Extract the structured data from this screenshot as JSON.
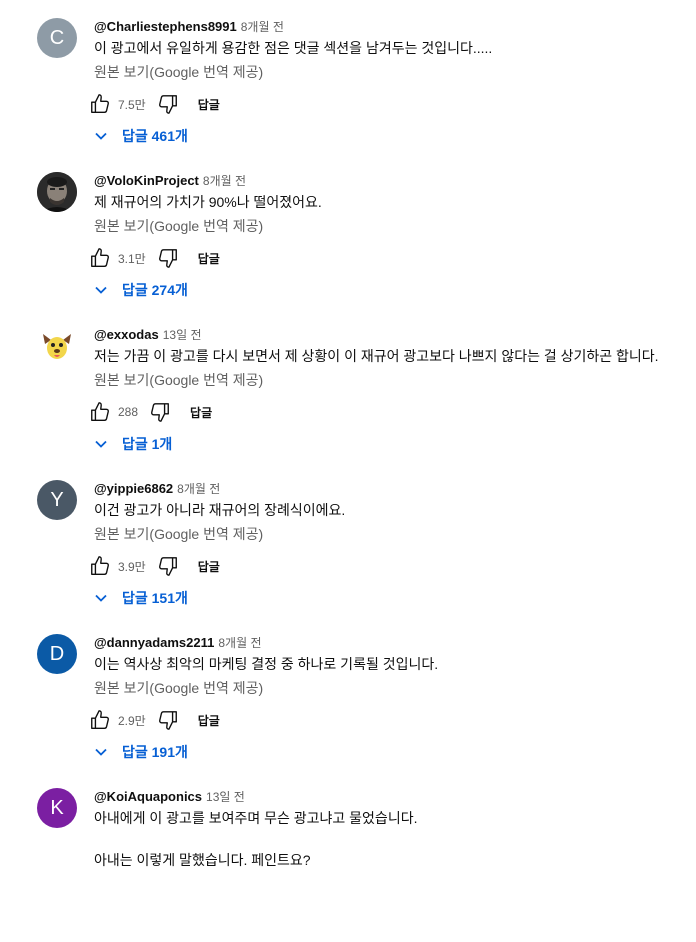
{
  "translate_label": "원본 보기(Google 번역 제공)",
  "reply_label": "답글",
  "comments": [
    {
      "initial": "C",
      "avatar_color": "#8e9ba6",
      "author": "@Charliestephens8991",
      "time": "8개월 전",
      "text": "이 광고에서 유일하게 용감한 점은 댓글 섹션을 남겨두는 것입니다.....",
      "likes": "7.5만",
      "replies": "답글 461개"
    },
    {
      "initial": "",
      "avatar_color": "#3a3a3a",
      "author": "@VoloKinProject",
      "time": "8개월 전",
      "text": "제 재규어의 가치가 90%나 떨어졌어요.",
      "likes": "3.1만",
      "replies": "답글 274개"
    },
    {
      "initial": "",
      "avatar_color": "#ffffff",
      "author": "@exxodas",
      "time": "13일 전",
      "text": "저는 가끔 이 광고를 다시 보면서 제 상황이 이 재규어 광고보다 나쁘지 않다는 걸 상기하곤 합니다.",
      "likes": "288",
      "replies": "답글 1개"
    },
    {
      "initial": "Y",
      "avatar_color": "#4a5866",
      "author": "@yippie6862",
      "time": "8개월 전",
      "text": "이건 광고가 아니라 재규어의 장례식이에요.",
      "likes": "3.9만",
      "replies": "답글 151개"
    },
    {
      "initial": "D",
      "avatar_color": "#0b5aa6",
      "author": "@dannyadams2211",
      "time": "8개월 전",
      "text": "이는 역사상 최악의 마케팅 결정 중 하나로 기록될 것입니다.",
      "likes": "2.9만",
      "replies": "답글 191개"
    },
    {
      "initial": "K",
      "avatar_color": "#7b1fa2",
      "author": "@KoiAquaponics",
      "time": "13일 전",
      "text": "아내에게 이 광고를 보여주며 무슨 광고냐고 물었습니다.",
      "text2": "아내는 이렇게 말했습니다. 페인트요?"
    }
  ]
}
